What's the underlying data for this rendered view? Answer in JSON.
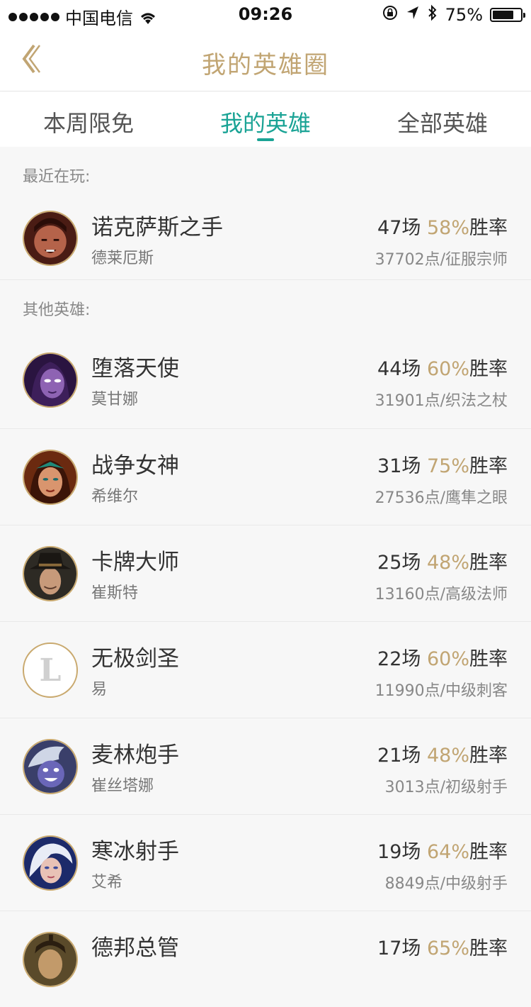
{
  "status_bar": {
    "carrier": "中国电信",
    "time": "09:26",
    "battery": "75%",
    "battery_level": 0.75
  },
  "nav": {
    "title": "我的英雄圈",
    "back_icon": "chevron-left-icon"
  },
  "tabs": [
    {
      "label": "本周限免",
      "active": false
    },
    {
      "label": "我的英雄",
      "active": true
    },
    {
      "label": "全部英雄",
      "active": false
    }
  ],
  "recent": {
    "header": "最近在玩:",
    "heroes": [
      {
        "name": "诺克萨斯之手",
        "title": "德莱厄斯",
        "games": "47场",
        "rate": "58%",
        "rate_suffix": "胜率",
        "points": "37702点/征服宗师"
      }
    ]
  },
  "others": {
    "header": "其他英雄:",
    "heroes": [
      {
        "name": "堕落天使",
        "title": "莫甘娜",
        "games": "44场",
        "rate": "60%",
        "rate_suffix": "胜率",
        "points": "31901点/织法之杖"
      },
      {
        "name": "战争女神",
        "title": "希维尔",
        "games": "31场",
        "rate": "75%",
        "rate_suffix": "胜率",
        "points": "27536点/鹰隼之眼"
      },
      {
        "name": "卡牌大师",
        "title": "崔斯特",
        "games": "25场",
        "rate": "48%",
        "rate_suffix": "胜率",
        "points": "13160点/高级法师"
      },
      {
        "name": "无极剑圣",
        "title": "易",
        "games": "22场",
        "rate": "60%",
        "rate_suffix": "胜率",
        "points": "11990点/中级刺客"
      },
      {
        "name": "麦林炮手",
        "title": "崔丝塔娜",
        "games": "21场",
        "rate": "48%",
        "rate_suffix": "胜率",
        "points": "3013点/初级射手"
      },
      {
        "name": "寒冰射手",
        "title": "艾希",
        "games": "19场",
        "rate": "64%",
        "rate_suffix": "胜率",
        "points": "8849点/中级射手"
      },
      {
        "name": "德邦总管",
        "title": "",
        "games": "17场",
        "rate": "65%",
        "rate_suffix": "胜率",
        "points": ""
      }
    ]
  },
  "colors": {
    "accent_gold": "#c1a573",
    "tab_active": "#1aa395",
    "background": "#f7f7f7"
  }
}
